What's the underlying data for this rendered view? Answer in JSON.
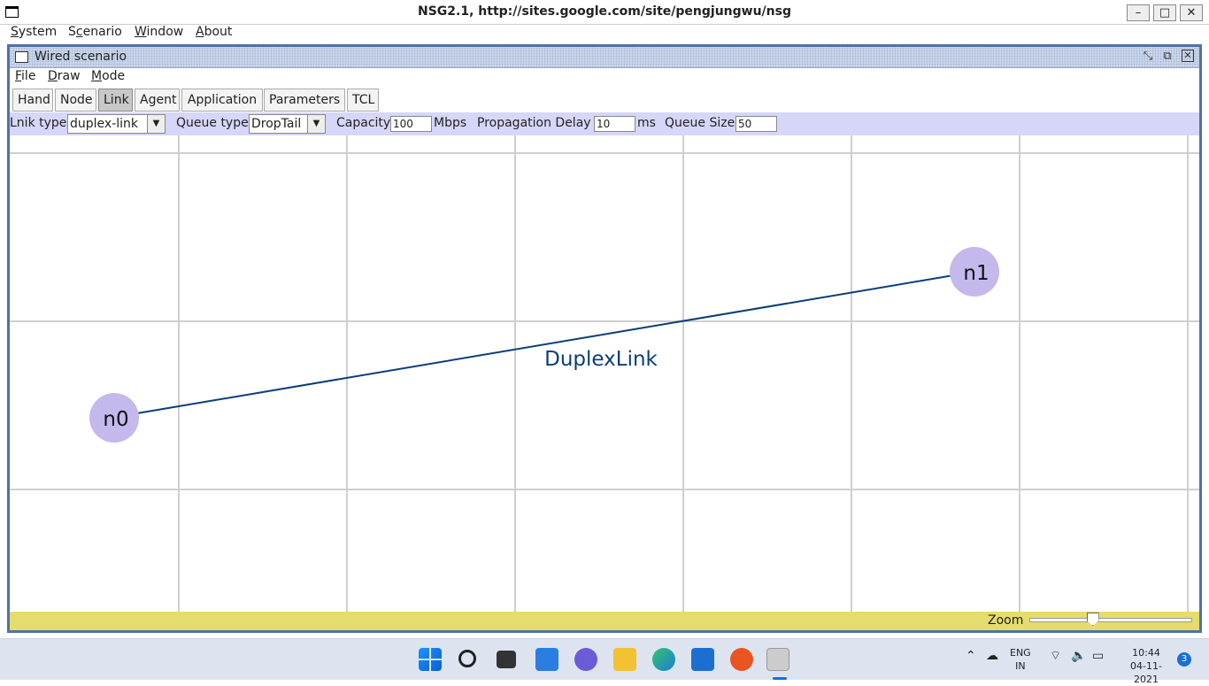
{
  "window": {
    "title": "NSG2.1, http://sites.google.com/site/pengjungwu/nsg",
    "minimize": "–",
    "maximize": "□",
    "close": "✕"
  },
  "menubar": [
    {
      "label": "System",
      "ul": "S",
      "rest": "ystem"
    },
    {
      "label": "Scenario",
      "ul": "c",
      "pre": "S",
      "rest": "enario"
    },
    {
      "label": "Window",
      "ul": "W",
      "rest": "indow"
    },
    {
      "label": "About",
      "ul": "A",
      "rest": "bout"
    }
  ],
  "frame": {
    "title": "Wired scenario",
    "menu": {
      "file": "File",
      "draw": "Draw",
      "mode": "Mode"
    }
  },
  "toolbar": {
    "hand": "Hand",
    "node": "Node",
    "link": "Link",
    "agent": "Agent",
    "application": "Application",
    "parameters": "Parameters",
    "tcl": "TCL",
    "active": "Link"
  },
  "options": {
    "link_type_label": "Lnik type",
    "link_type_value": "duplex-link",
    "queue_type_label": "Queue type",
    "queue_type_value": "DropTail",
    "capacity_label": "Capacity",
    "capacity_value": "100",
    "capacity_unit": "Mbps",
    "prop_delay_label": "Propagation Delay",
    "prop_delay_value": "10",
    "prop_delay_unit": "ms",
    "queue_size_label": "Queue Size",
    "queue_size_value": "50"
  },
  "canvas": {
    "nodes": [
      {
        "id": "n0",
        "label": "n0"
      },
      {
        "id": "n1",
        "label": "n1"
      }
    ],
    "link_label": "DuplexLink",
    "node_color": "#c4b8ec",
    "link_color": "#0a3e7a"
  },
  "status": {
    "zoom_label": "Zoom",
    "zoom_level": 0.38
  },
  "taskbar": {
    "lang_top": "ENG",
    "lang_bottom": "IN",
    "time": "10:44",
    "date": "04-11-2021",
    "notifications": "3"
  }
}
